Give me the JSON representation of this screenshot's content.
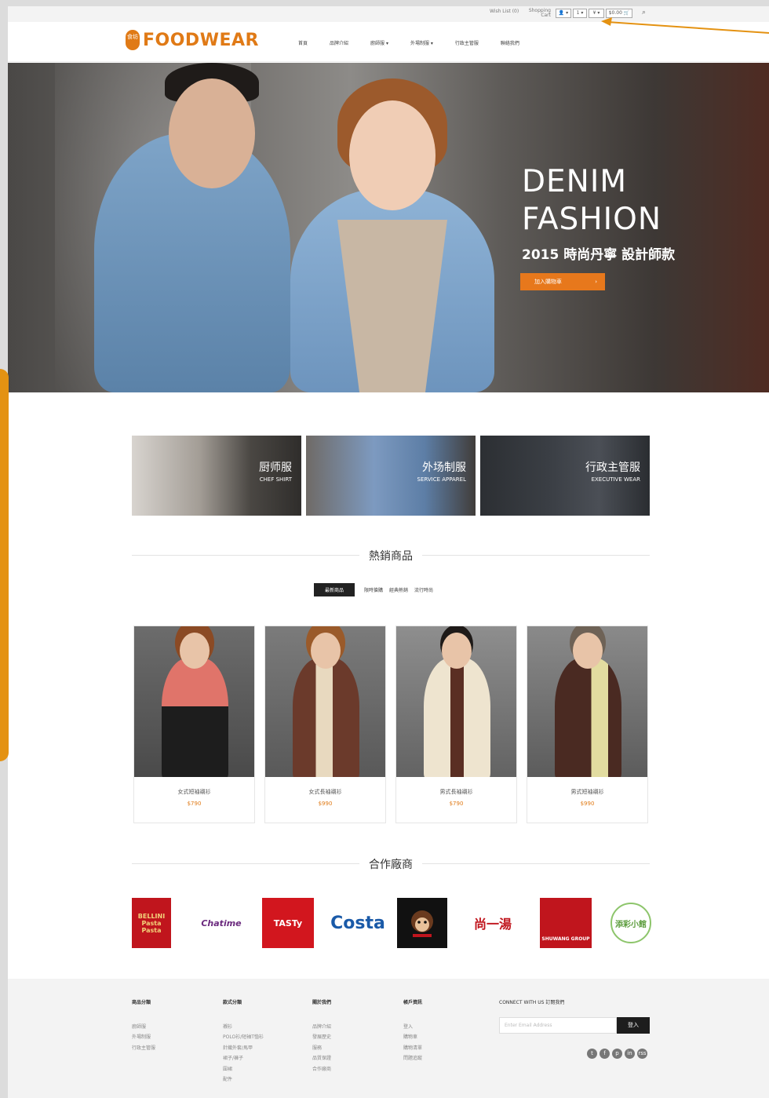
{
  "util": {
    "wishlist": "Wish List (0)",
    "shopping_cart": "Shopping Cart",
    "user_btn": "👤 ▾",
    "lang_btn": "1 ▾",
    "curr_btn": "¥ ▾",
    "cart_btn": "$0.00 🛒",
    "search_icon": "⌕"
  },
  "logo": {
    "badge": "食坊",
    "text": "FOODWEAR"
  },
  "menu": [
    "首頁",
    "品牌介紹",
    "廚師服 ▾",
    "外場制服 ▾",
    "行政主管服",
    "聯絡我們"
  ],
  "hero": {
    "title_line1": "DENIM",
    "title_line2": "FASHION",
    "subtitle": "2015 時尚丹寧 設計師款",
    "button": "加入購物車",
    "button_chev": "›"
  },
  "categories": [
    {
      "zh": "厨师服",
      "en": "CHEF SHIRT"
    },
    {
      "zh": "外场制服",
      "en": "SERVICE APPAREL"
    },
    {
      "zh": "行政主管服",
      "en": "EXECUTIVE WEAR"
    }
  ],
  "hot": {
    "title": "熱銷商品",
    "tabs": [
      "最新商品",
      "限時搶購",
      "經典熱銷",
      "流行時尚"
    ]
  },
  "products": [
    {
      "name": "女式短袖襯衫",
      "price": "$790"
    },
    {
      "name": "女式長袖襯衫",
      "price": "$990"
    },
    {
      "name": "男式長袖襯衫",
      "price": "$790"
    },
    {
      "name": "男式短袖襯衫",
      "price": "$990"
    }
  ],
  "partners_title": "合作廠商",
  "partners": [
    "BELLINI Pasta Pasta",
    "Chatime",
    "TASTy",
    "Costa",
    "",
    "尚一湯",
    "SHUWANG GROUP",
    "添彩小館"
  ],
  "footer": {
    "col1": {
      "h": "商品分類",
      "items": [
        "廚師服",
        "外場制服",
        "行政主管服"
      ]
    },
    "col2": {
      "h": "款式分類",
      "items": [
        "襯衫",
        "POLO衫/短袖T恤衫",
        "針織外套/馬甲",
        "裙子/褲子",
        "圍裙",
        "配件"
      ]
    },
    "col3": {
      "h": "關於我們",
      "items": [
        "品牌介紹",
        "發展歷史",
        "服務",
        "品質保證",
        "合作廠商"
      ]
    },
    "col4": {
      "h": "帳戶資訊",
      "items": [
        "登入",
        "購物車",
        "購物清單",
        "問題追蹤"
      ]
    },
    "connect": "CONNECT WITH US  訂閱我們",
    "email_placeholder": "Enter Email Address",
    "subscribe": "登入",
    "social": [
      "t",
      "f",
      "p",
      "in",
      "rss"
    ]
  },
  "colors": {
    "accent": "#e07a16",
    "annotation": "#e49212"
  }
}
